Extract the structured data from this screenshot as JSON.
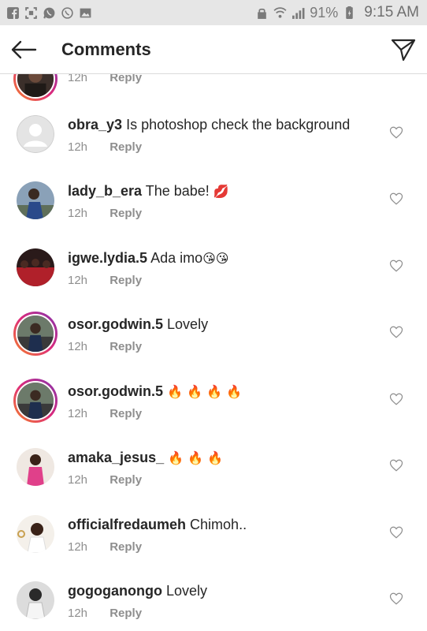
{
  "status_bar": {
    "battery": "91%",
    "time": "9:15 AM"
  },
  "header": {
    "title": "Comments"
  },
  "comments": [
    {
      "username": "",
      "text": "",
      "time": "12h",
      "reply": "Reply",
      "avatar": "partial"
    },
    {
      "username": "obra_y3",
      "text": "Is photoshop check the background",
      "time": "12h",
      "reply": "Reply",
      "avatar": "default"
    },
    {
      "username": "lady_b_era",
      "text": "The babe!",
      "emojis": "💋",
      "time": "12h",
      "reply": "Reply",
      "avatar": "photo"
    },
    {
      "username": "igwe.lydia.5",
      "text": "Ada imo",
      "emojis": "😘😘",
      "time": "12h",
      "reply": "Reply",
      "avatar": "photo"
    },
    {
      "username": "osor.godwin.5",
      "text": "Lovely",
      "time": "12h",
      "reply": "Reply",
      "avatar": "story"
    },
    {
      "username": "osor.godwin.5",
      "text": "",
      "emojis": "🔥 🔥 🔥 🔥",
      "time": "12h",
      "reply": "Reply",
      "avatar": "story"
    },
    {
      "username": "amaka_jesus_",
      "text": "",
      "emojis": "🔥 🔥 🔥",
      "time": "12h",
      "reply": "Reply",
      "avatar": "photo"
    },
    {
      "username": "officialfredaumeh",
      "text": "Chimoh..",
      "time": "12h",
      "reply": "Reply",
      "avatar": "photo"
    },
    {
      "username": "gogoganongo",
      "text": "Lovely",
      "time": "12h",
      "reply": "Reply",
      "avatar": "photo"
    }
  ],
  "colors": {
    "status_bar_bg": "#e6e6e6",
    "text": "#262626",
    "meta": "#8e8e8e",
    "divider": "#dbdbdb",
    "story_ring": "#dd2a7b"
  }
}
